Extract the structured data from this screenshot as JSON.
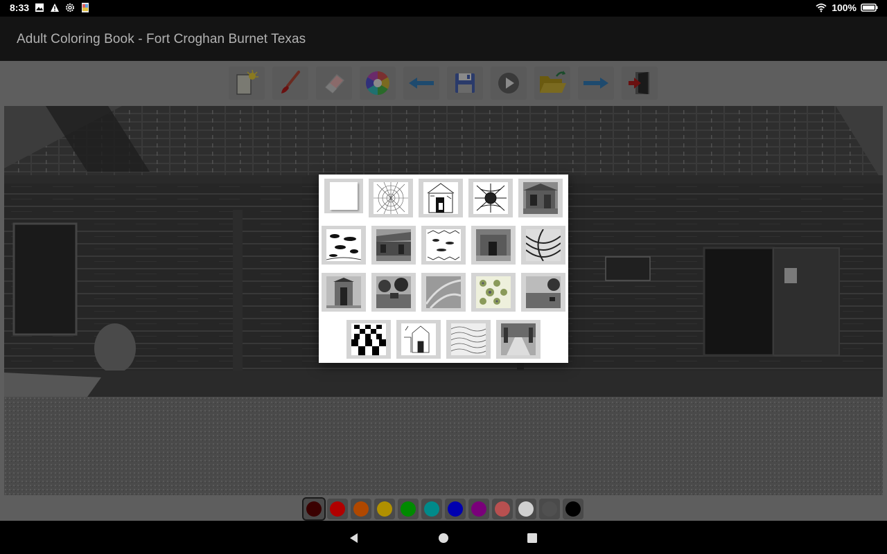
{
  "status": {
    "time": "8:33",
    "battery": "100%",
    "icons": [
      "image-icon",
      "warning-icon",
      "settings-icon",
      "app-notification-icon",
      "wifi-icon",
      "battery-icon"
    ]
  },
  "app": {
    "title": "Adult Coloring Book - Fort Croghan Burnet Texas"
  },
  "toolbar": {
    "tools": [
      {
        "name": "new-page",
        "icon": "new-page-icon"
      },
      {
        "name": "brush",
        "icon": "brush-icon"
      },
      {
        "name": "eraser",
        "icon": "eraser-icon"
      },
      {
        "name": "color-wheel",
        "icon": "color-wheel-icon"
      },
      {
        "name": "undo",
        "icon": "arrow-left-icon"
      },
      {
        "name": "save",
        "icon": "floppy-disk-icon"
      },
      {
        "name": "play",
        "icon": "play-icon"
      },
      {
        "name": "open",
        "icon": "open-folder-icon"
      },
      {
        "name": "redo",
        "icon": "arrow-right-icon"
      },
      {
        "name": "exit",
        "icon": "exit-door-icon"
      }
    ]
  },
  "palette": {
    "colors": [
      "#3a0000",
      "#b00000",
      "#b04800",
      "#b09000",
      "#008a00",
      "#008a8a",
      "#0000b0",
      "#7a007a",
      "#b85050",
      "#d0d0d0",
      "#505050",
      "#000000"
    ],
    "selected_index": 0
  },
  "picker": {
    "thumbnails": [
      "blank-page",
      "radial-pattern",
      "fort-doorway-sketch",
      "mandala-sketch",
      "cabin-photo",
      "clouds-sketch",
      "log-cabin-photo",
      "pattern-sketch",
      "stone-building-photo",
      "swirl-pattern",
      "outhouse-photo",
      "trees-photo",
      "abstract-curves",
      "floral-pattern",
      "yard-photo",
      "checkerboard-pattern",
      "building-sketch",
      "wave-pattern",
      "walkway-photo"
    ]
  },
  "nav": {
    "buttons": [
      "back-icon",
      "home-icon",
      "recents-icon"
    ]
  }
}
